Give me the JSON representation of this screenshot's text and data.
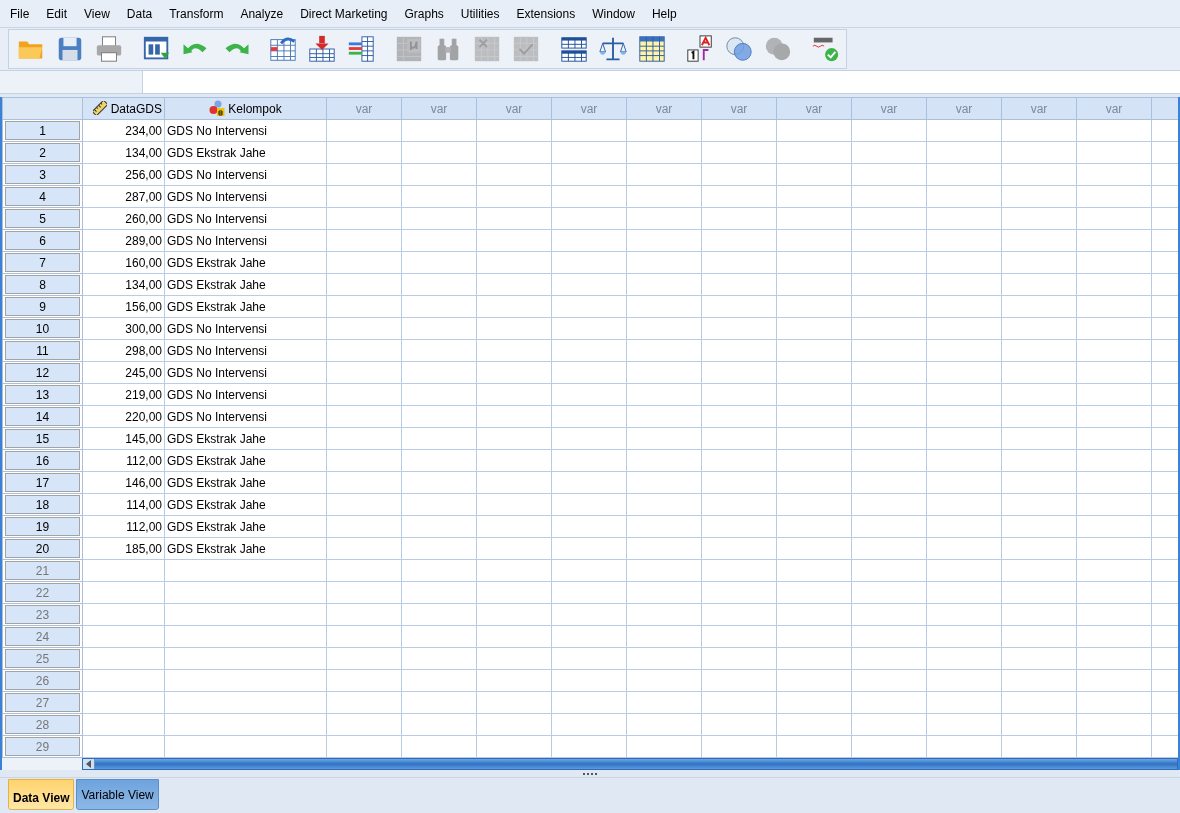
{
  "menu": [
    "File",
    "Edit",
    "View",
    "Data",
    "Transform",
    "Analyze",
    "Direct Marketing",
    "Graphs",
    "Utilities",
    "Extensions",
    "Window",
    "Help"
  ],
  "toolbar": [
    {
      "kind": "open",
      "disabled": false
    },
    {
      "kind": "save",
      "disabled": false
    },
    {
      "kind": "print",
      "disabled": false
    },
    {
      "kind": "dialog",
      "disabled": false
    },
    {
      "kind": "undo",
      "disabled": false
    },
    {
      "kind": "redo",
      "disabled": false
    },
    {
      "kind": "goto-case",
      "disabled": false
    },
    {
      "kind": "goto-variable",
      "disabled": false
    },
    {
      "kind": "variables",
      "disabled": false
    },
    {
      "kind": "descriptives",
      "disabled": true
    },
    {
      "kind": "find",
      "disabled": true
    },
    {
      "kind": "insert-cases",
      "disabled": true
    },
    {
      "kind": "insert-variable",
      "disabled": true
    },
    {
      "kind": "split",
      "disabled": false
    },
    {
      "kind": "weight",
      "disabled": false
    },
    {
      "kind": "select",
      "disabled": false
    },
    {
      "kind": "labels",
      "disabled": false
    },
    {
      "kind": "sets",
      "disabled": false
    },
    {
      "kind": "sets",
      "disabled": true
    },
    {
      "kind": "spell",
      "disabled": false
    }
  ],
  "columns": [
    {
      "label": "DataGDS",
      "kind": "scale"
    },
    {
      "label": "Kelompok",
      "kind": "nominal"
    },
    {
      "label": "var",
      "kind": "empty"
    },
    {
      "label": "var",
      "kind": "empty"
    },
    {
      "label": "var",
      "kind": "empty"
    },
    {
      "label": "var",
      "kind": "empty"
    },
    {
      "label": "var",
      "kind": "empty"
    },
    {
      "label": "var",
      "kind": "empty"
    },
    {
      "label": "var",
      "kind": "empty"
    },
    {
      "label": "var",
      "kind": "empty"
    },
    {
      "label": "var",
      "kind": "empty"
    },
    {
      "label": "var",
      "kind": "empty"
    },
    {
      "label": "var",
      "kind": "empty"
    }
  ],
  "rows": [
    {
      "number": "1",
      "cells": [
        "234,00",
        "GDS No Intervensi"
      ]
    },
    {
      "number": "2",
      "cells": [
        "134,00",
        "GDS Ekstrak Jahe"
      ]
    },
    {
      "number": "3",
      "cells": [
        "256,00",
        "GDS No Intervensi"
      ]
    },
    {
      "number": "4",
      "cells": [
        "287,00",
        "GDS No Intervensi"
      ]
    },
    {
      "number": "5",
      "cells": [
        "260,00",
        "GDS No Intervensi"
      ]
    },
    {
      "number": "6",
      "cells": [
        "289,00",
        "GDS No Intervensi"
      ]
    },
    {
      "number": "7",
      "cells": [
        "160,00",
        "GDS Ekstrak Jahe"
      ]
    },
    {
      "number": "8",
      "cells": [
        "134,00",
        "GDS Ekstrak Jahe"
      ]
    },
    {
      "number": "9",
      "cells": [
        "156,00",
        "GDS Ekstrak Jahe"
      ]
    },
    {
      "number": "10",
      "cells": [
        "300,00",
        "GDS No Intervensi"
      ]
    },
    {
      "number": "11",
      "cells": [
        "298,00",
        "GDS No Intervensi"
      ]
    },
    {
      "number": "12",
      "cells": [
        "245,00",
        "GDS No Intervensi"
      ]
    },
    {
      "number": "13",
      "cells": [
        "219,00",
        "GDS No Intervensi"
      ]
    },
    {
      "number": "14",
      "cells": [
        "220,00",
        "GDS No Intervensi"
      ]
    },
    {
      "number": "15",
      "cells": [
        "145,00",
        "GDS Ekstrak Jahe"
      ]
    },
    {
      "number": "16",
      "cells": [
        "112,00",
        "GDS Ekstrak Jahe"
      ]
    },
    {
      "number": "17",
      "cells": [
        "146,00",
        "GDS Ekstrak Jahe"
      ]
    },
    {
      "number": "18",
      "cells": [
        "114,00",
        "GDS Ekstrak Jahe"
      ]
    },
    {
      "number": "19",
      "cells": [
        "112,00",
        "GDS Ekstrak Jahe"
      ]
    },
    {
      "number": "20",
      "cells": [
        "185,00",
        "GDS Ekstrak Jahe"
      ]
    },
    {
      "number": "21",
      "cells": []
    },
    {
      "number": "22",
      "cells": []
    },
    {
      "number": "23",
      "cells": []
    },
    {
      "number": "24",
      "cells": []
    },
    {
      "number": "25",
      "cells": []
    },
    {
      "number": "26",
      "cells": []
    },
    {
      "number": "27",
      "cells": []
    },
    {
      "number": "28",
      "cells": []
    },
    {
      "number": "29",
      "cells": []
    }
  ],
  "tabs": [
    {
      "label": "Data View",
      "selected": true
    },
    {
      "label": "Variable View",
      "selected": false
    }
  ]
}
